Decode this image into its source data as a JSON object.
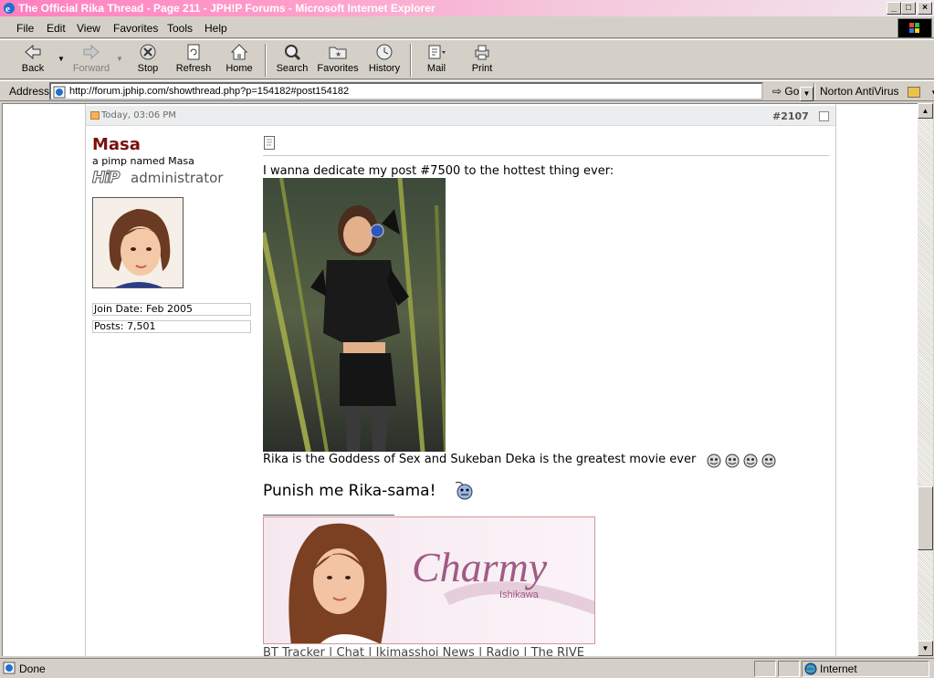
{
  "window": {
    "title": "The Official Rika Thread - Page 211 - JPH!P Forums - Microsoft Internet Explorer",
    "minimize": "_",
    "maximize": "□",
    "close": "×"
  },
  "menu": [
    "File",
    "Edit",
    "View",
    "Favorites",
    "Tools",
    "Help"
  ],
  "toolbar": {
    "back": "Back",
    "forward": "Forward",
    "stop": "Stop",
    "refresh": "Refresh",
    "home": "Home",
    "search": "Search",
    "favorites": "Favorites",
    "history": "History",
    "mail": "Mail",
    "print": "Print"
  },
  "address": {
    "label": "Address",
    "url": "http://forum.jphip.com/showthread.php?p=154182#post154182",
    "go": "Go",
    "norton": "Norton AntiVirus"
  },
  "post": {
    "date": "Today, 03:06 PM",
    "number": "#2107",
    "username": "Masa",
    "user_title": "a pimp named Masa",
    "rank_logo": "HiP",
    "rank": "administrator",
    "join_date": "Join Date: Feb 2005",
    "posts": "Posts: 7,501",
    "line1": "I wanna dedicate my post #7500 to the hottest thing ever:",
    "line2": "Rika is the Goddess of Sex and Sukeban Deka is the greatest movie ever",
    "line3": "Punish me Rika-sama!",
    "banner_title": "Charmy",
    "banner_sub": "Ishikawa",
    "sig_links": [
      "BT Tracker",
      "Chat",
      "Ikimasshoi News",
      "Radio",
      "The RIVE"
    ]
  },
  "status": {
    "text": "Done",
    "zone": "Internet"
  },
  "colors": {
    "username": "#7a1010",
    "titlebar_start": "#ff7fbf"
  }
}
